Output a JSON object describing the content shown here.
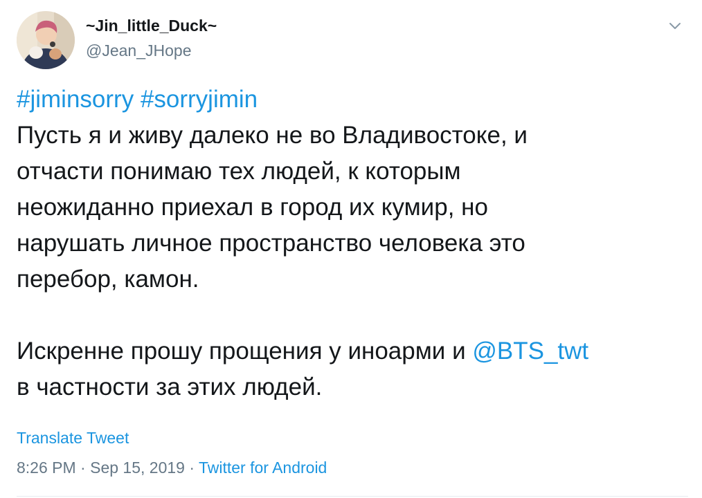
{
  "user": {
    "display_name": "~Jin_little_Duck~",
    "handle": "@Jean_JHope"
  },
  "tweet": {
    "hashtags": [
      "#jiminsorry",
      "#sorryjimin"
    ],
    "lines": [
      "Пусть я и живу далеко не во Владивостоке, и",
      "отчасти понимаю тех людей, к которым",
      "неожиданно приехал в город их кумир, но",
      "нарушать личное пространство человека это",
      "перебор, камон."
    ],
    "paragraph2_prefix": "Искренне прошу прощения у иноарми и ",
    "mention": "@BTS_twt",
    "paragraph2_last": "в частности за этих людей."
  },
  "actions": {
    "translate_label": "Translate Tweet"
  },
  "meta": {
    "time": "8:26 PM",
    "separator": " · ",
    "date": "Sep 15, 2019",
    "source": "Twitter for Android"
  },
  "colors": {
    "link": "#1b95e0",
    "text": "#14171a",
    "muted": "#657786"
  },
  "icons": {
    "caret": "chevron-down-icon",
    "avatar": "avatar"
  }
}
